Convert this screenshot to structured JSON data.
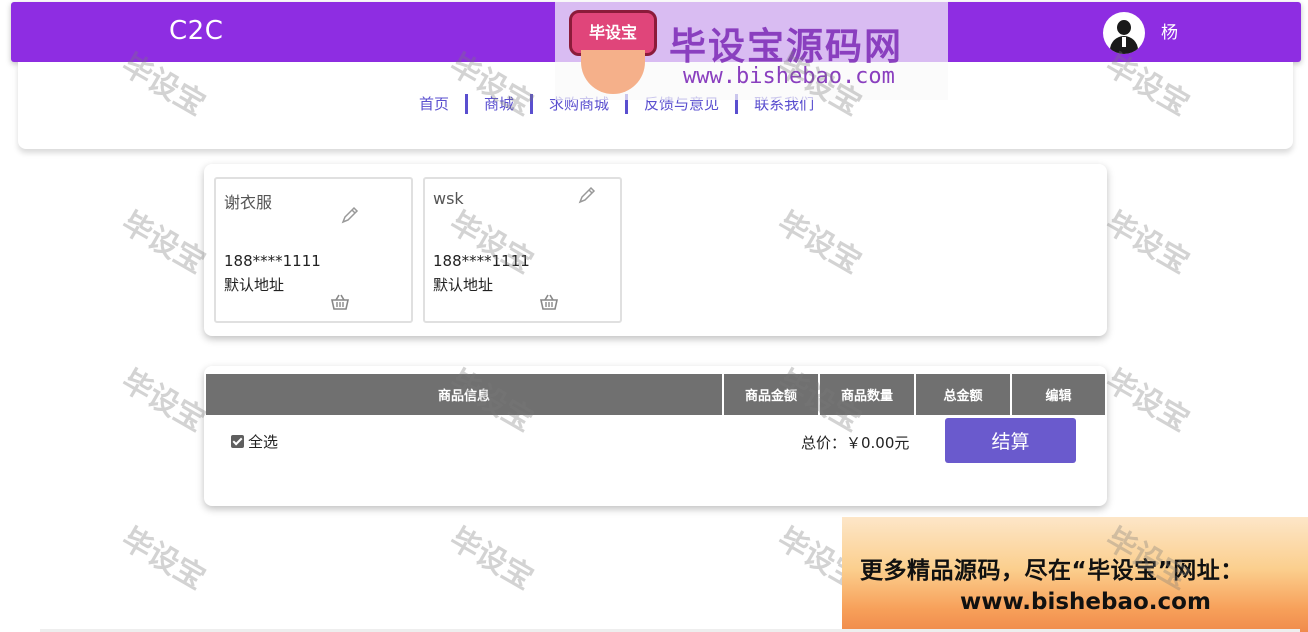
{
  "header": {
    "brand": "C2C",
    "username": "杨"
  },
  "nav": {
    "items": [
      "首页",
      "商城",
      "求购商城",
      "反馈与意见",
      "联系我们"
    ]
  },
  "overlay": {
    "logo_text": "毕设宝",
    "title": "毕设宝源码网",
    "url": "www.bishebao.com"
  },
  "addresses": [
    {
      "name": "谢衣服",
      "phone": "188****1111",
      "tag": "默认地址"
    },
    {
      "name": "wsk",
      "phone": "188****1111",
      "tag": "默认地址"
    }
  ],
  "cart": {
    "headers": {
      "info": "商品信息",
      "price": "商品金额",
      "qty": "商品数量",
      "total": "总金额",
      "edit": "编辑"
    },
    "select_all": "全选",
    "total_text": "总价：￥0.00元",
    "checkout": "结算"
  },
  "banner": {
    "line1": "更多精品源码，尽在“毕设宝”网址：",
    "line2": "www.bishebao.com"
  },
  "watermark": "毕设宝",
  "colors": {
    "header": "#8e2de2",
    "nav_text": "#5a4fcf",
    "checkout": "#6a5acd",
    "table_header": "#707070"
  }
}
